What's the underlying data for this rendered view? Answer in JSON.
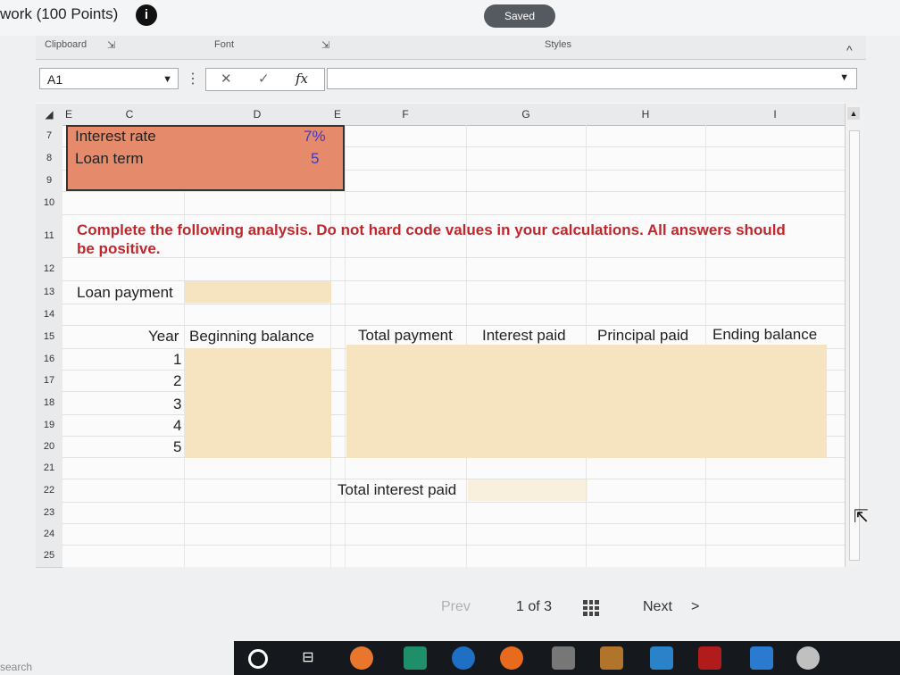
{
  "header": {
    "title": "work (100 Points)",
    "info_icon": "i",
    "saved": "Saved"
  },
  "ribbon": {
    "clipboard": "Clipboard",
    "font": "Font",
    "styles": "Styles",
    "collapse": "^"
  },
  "formula_bar": {
    "name_box": "A1",
    "dots": "⋮",
    "cancel": "✕",
    "enter": "✓",
    "fx": "fx",
    "value": ""
  },
  "columns": [
    "E",
    "C",
    "D",
    "E",
    "F",
    "G",
    "H",
    "I"
  ],
  "rows": [
    "7",
    "8",
    "9",
    "10",
    "11",
    "12",
    "13",
    "14",
    "15",
    "16",
    "17",
    "18",
    "19",
    "20",
    "21",
    "22",
    "23",
    "24",
    "25"
  ],
  "inputs": {
    "interest_rate_label": "Interest rate",
    "interest_rate_value": "7%",
    "loan_term_label": "Loan term",
    "loan_term_value": "5"
  },
  "instruction": "Complete the following analysis. Do not hard code values in your calculations. All answers should be positive.",
  "loan_payment_label": "Loan payment",
  "table": {
    "headers": [
      "Year",
      "Beginning balance",
      "Total payment",
      "Interest paid",
      "Principal paid",
      "Ending balance"
    ],
    "years": [
      "1",
      "2",
      "3",
      "4",
      "5"
    ]
  },
  "total_interest_label": "Total interest paid",
  "pager": {
    "prev": "Prev",
    "position": "1 of 3",
    "next": "Next",
    "next_icon": ">"
  },
  "footer": {
    "search": "search"
  },
  "colors": {
    "orange": "#e58a6a",
    "tan": "#f6e3c0",
    "red_text": "#c0272d",
    "blue_text": "#3a3ad0"
  }
}
